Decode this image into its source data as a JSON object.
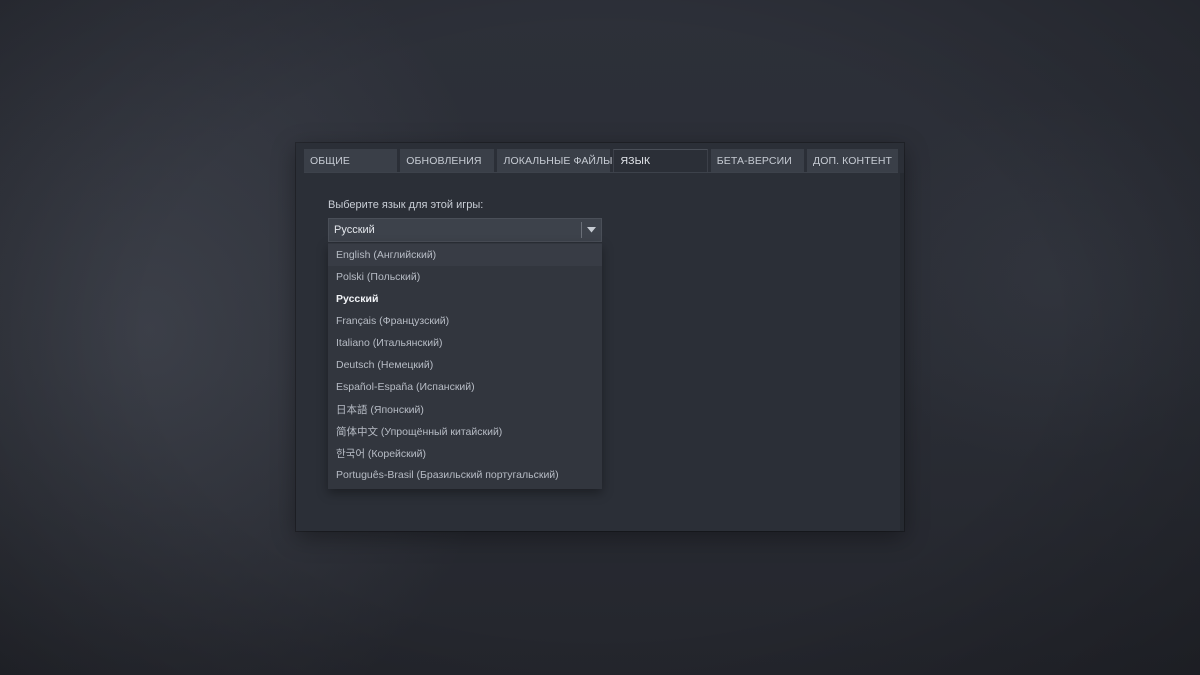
{
  "tabs": [
    {
      "label": "ОБЩИЕ",
      "active": false
    },
    {
      "label": "ОБНОВЛЕНИЯ",
      "active": false
    },
    {
      "label": "ЛОКАЛЬНЫЕ ФАЙЛЫ",
      "active": false
    },
    {
      "label": "ЯЗЫК",
      "active": true
    },
    {
      "label": "БЕТА-ВЕРСИИ",
      "active": false
    },
    {
      "label": "ДОП. КОНТЕНТ",
      "active": false
    }
  ],
  "language": {
    "prompt": "Выберите язык для этой игры:",
    "selected": "Русский",
    "options": [
      "English (Английский)",
      "Polski (Польский)",
      "Русский",
      "Français (Французский)",
      "Italiano (Итальянский)",
      "Deutsch (Немецкий)",
      "Español-España (Испанский)",
      "日本語 (Японский)",
      "简体中文 (Упрощённый китайский)",
      "한국어 (Корейский)",
      "Português-Brasil (Бразильский португальский)"
    ],
    "selected_index": 2
  },
  "colors": {
    "background": "#2a2d35",
    "dialog": "#2b2f37",
    "tab_inactive": "#3a3f48",
    "select_bg": "#3d424b",
    "dropdown_bg": "#32363e",
    "text": "#c6cbd3",
    "text_selected": "#f2f4f7"
  },
  "icons": {
    "select_arrow": "chevron-down-icon"
  }
}
